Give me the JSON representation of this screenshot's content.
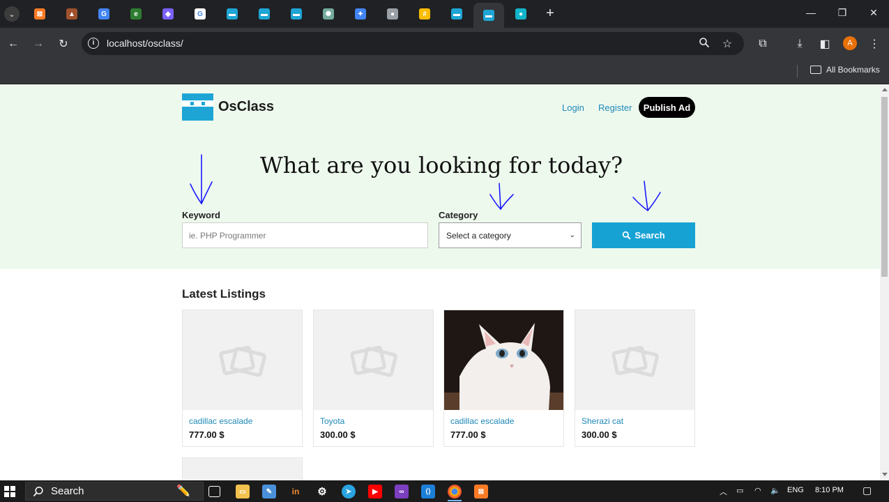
{
  "browser": {
    "tabs": [
      {
        "name": "xampp-tab",
        "color": "#fb7a24",
        "glyph": "⊠"
      },
      {
        "name": "ask-tab",
        "color": "#a0522d",
        "glyph": "▲"
      },
      {
        "name": "translate-tab",
        "color": "#4285f4",
        "glyph": "G"
      },
      {
        "name": "sheets-tab",
        "color": "#2e7d32",
        "glyph": "e"
      },
      {
        "name": "shield-tab",
        "color": "#7b61ff",
        "glyph": "◆"
      },
      {
        "name": "google-tab",
        "color": "#ffffff",
        "glyph": "G"
      },
      {
        "name": "osclass-tab-1",
        "color": "#1ea5d5",
        "glyph": "▬"
      },
      {
        "name": "osclass-tab-2",
        "color": "#1ea5d5",
        "glyph": "▬"
      },
      {
        "name": "osclass-tab-3",
        "color": "#1ea5d5",
        "glyph": "▬"
      },
      {
        "name": "chatgpt-tab",
        "color": "#74aa9c",
        "glyph": "✺"
      },
      {
        "name": "gemini-tab",
        "color": "#4285f4",
        "glyph": "✦"
      },
      {
        "name": "globe-tab",
        "color": "#9aa0a6",
        "glyph": "●"
      },
      {
        "name": "notes-tab",
        "color": "#fbbc04",
        "glyph": "#"
      },
      {
        "name": "osclass-tab-4",
        "color": "#1ea5d5",
        "glyph": "▬"
      },
      {
        "name": "osclass-tab-active",
        "color": "#1ea5d5",
        "glyph": "▬"
      },
      {
        "name": "app-tab",
        "color": "#12b5cb",
        "glyph": "●"
      }
    ],
    "url": "localhost/osclass/",
    "profile_initial": "A",
    "bookmarks_label": "All Bookmarks"
  },
  "site": {
    "brand": "OsClass",
    "nav": {
      "login": "Login",
      "register": "Register",
      "publish": "Publish Ad"
    },
    "hero_title": "What are you looking for today?",
    "search": {
      "keyword_label": "Keyword",
      "keyword_placeholder": "ie. PHP Programmer",
      "category_label": "Category",
      "category_selected": "Select a category",
      "button": "Search"
    },
    "latest_title": "Latest Listings",
    "listings": [
      {
        "title": "cadillac escalade",
        "price": "777.00 $",
        "has_photo": false
      },
      {
        "title": "Toyota",
        "price": "300.00 $",
        "has_photo": false
      },
      {
        "title": "cadillac escalade",
        "price": "777.00 $",
        "has_photo": true
      },
      {
        "title": "Sherazi cat",
        "price": "300.00 $",
        "has_photo": false
      }
    ]
  },
  "taskbar": {
    "search_label": "Search",
    "language": "ENG",
    "time": "8:10 PM"
  },
  "colors": {
    "accent": "#17a2d4",
    "link": "#1e88b8",
    "hero_bg": "#eef9ee",
    "annotation": "#1a1aff"
  }
}
